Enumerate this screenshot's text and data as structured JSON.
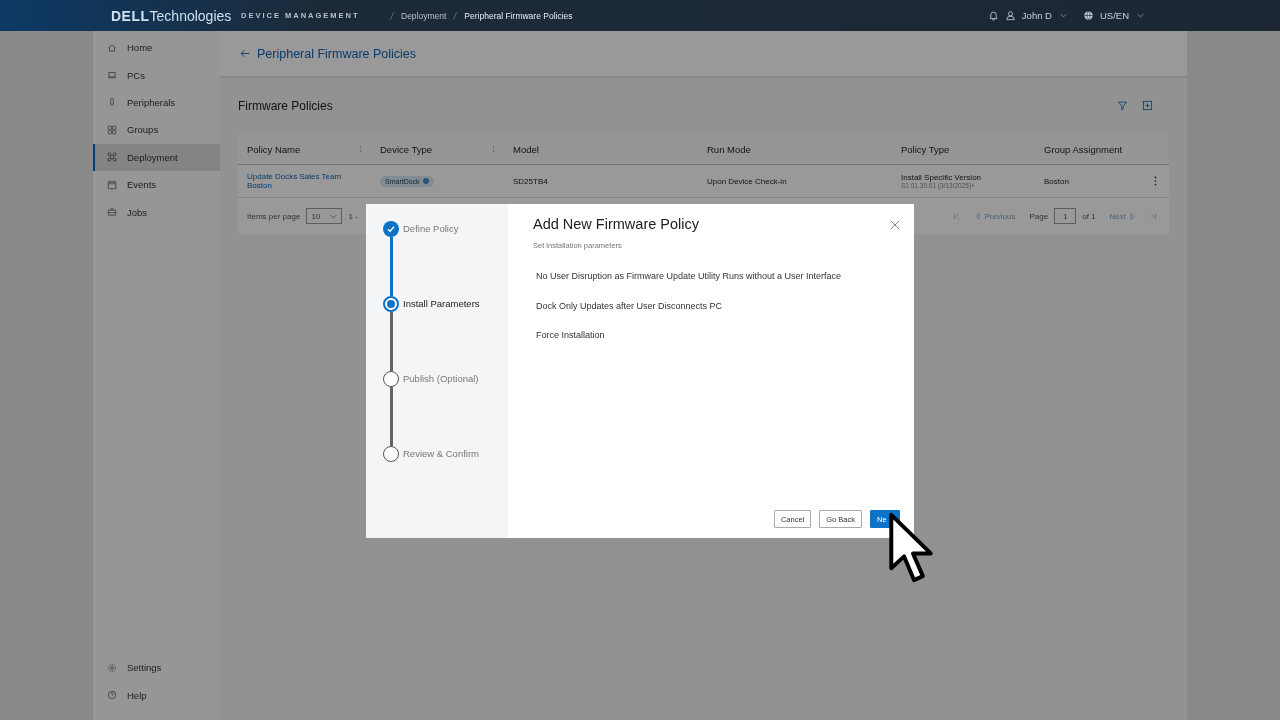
{
  "header": {
    "logo_bold": "DELL",
    "logo_light": "Technologies",
    "breadcrumb": [
      "DEVICE MANAGEMENT",
      "Deployment",
      "Peripheral Firmware Policies"
    ],
    "user": "John D",
    "locale": "US/EN"
  },
  "sidebar": {
    "items": [
      {
        "label": "Home",
        "selected": false
      },
      {
        "label": "PCs",
        "selected": false
      },
      {
        "label": "Peripherals",
        "selected": false
      },
      {
        "label": "Groups",
        "selected": false
      },
      {
        "label": "Deployment",
        "selected": true
      },
      {
        "label": "Events",
        "selected": false
      },
      {
        "label": "Jobs",
        "selected": false
      }
    ],
    "bottom_items": [
      {
        "label": "Settings",
        "selected": false
      },
      {
        "label": "Help",
        "selected": false
      }
    ]
  },
  "page": {
    "back_title": "Peripheral Firmware Policies",
    "section_title": "Firmware Policies"
  },
  "table": {
    "columns": [
      {
        "label": "Policy Name",
        "menu": true
      },
      {
        "label": "Device Type",
        "menu": true
      },
      {
        "label": "Model",
        "menu": false
      },
      {
        "label": "Run Mode",
        "menu": false
      },
      {
        "label": "Policy Type",
        "menu": false
      },
      {
        "label": "Group Assignment",
        "menu": false
      }
    ],
    "rows": [
      {
        "policy_name": "Update Docks Sales Team Boston",
        "device_type": "SmartDock",
        "model": "SD25TB4",
        "run_mode": "Upon Device Check-in",
        "policy_type": "Install Specific Version",
        "policy_version": "S1.01.30.01 (3/13/2025)+",
        "group": "Boston"
      }
    ]
  },
  "pagination": {
    "items_label": "Items per page",
    "page_size": "10",
    "range": "1 -",
    "previous": "Previous",
    "page_label": "Page",
    "page": "1",
    "of": "of 1",
    "next": "Next"
  },
  "dialog": {
    "title": "Add New Firmware Policy",
    "subtitle": "Set installation parameters",
    "steps": [
      {
        "label": "Define Policy",
        "completed": true,
        "selected": false
      },
      {
        "label": "Install Parameters",
        "completed": false,
        "selected": true
      },
      {
        "label": "Publish (Optional)",
        "completed": false,
        "selected": false
      },
      {
        "label": "Review & Confirm",
        "completed": false,
        "selected": false
      }
    ],
    "options": [
      "No User Disruption as Firmware Update Utility Runs without a User Interface",
      "Dock Only Updates after User Disconnects PC",
      "Force Installation"
    ],
    "buttons": [
      {
        "label": "Cancel",
        "kind": "secondary"
      },
      {
        "label": "Go Back",
        "kind": "secondary"
      },
      {
        "label": "Ne",
        "kind": "primary"
      }
    ]
  }
}
